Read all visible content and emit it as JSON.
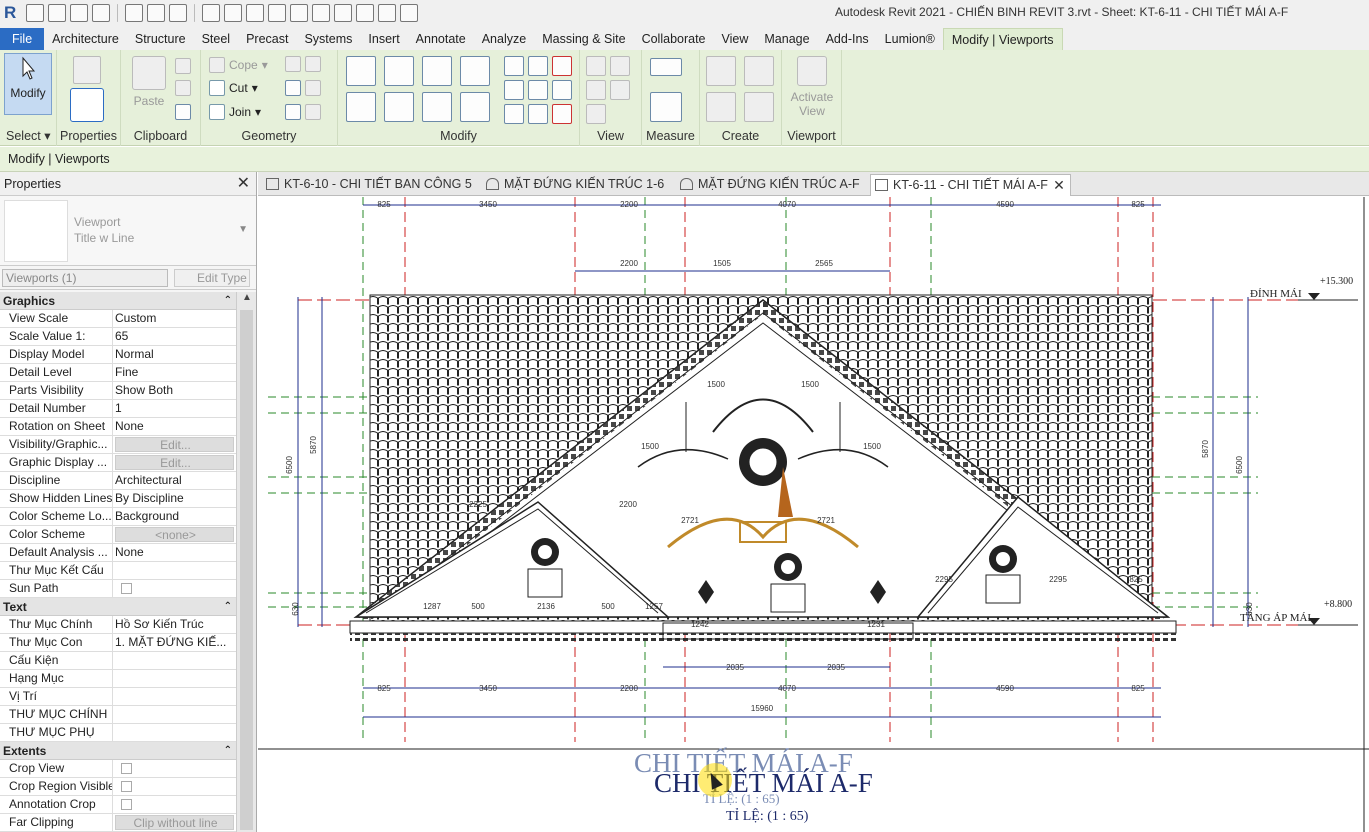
{
  "app": {
    "logo": "R",
    "title": "Autodesk Revit 2021 - CHIẾN BINH REVIT 3.rvt - Sheet: KT-6-11 - CHI TIẾT MÁI A-F"
  },
  "ribbon_tabs": [
    "File",
    "Architecture",
    "Structure",
    "Steel",
    "Precast",
    "Systems",
    "Insert",
    "Annotate",
    "Analyze",
    "Massing & Site",
    "Collaborate",
    "View",
    "Manage",
    "Add-Ins",
    "Lumion®",
    "Modify | Viewports"
  ],
  "active_tab": "Modify | Viewports",
  "ribbon": {
    "modify_label": "Modify",
    "select_label": "Select",
    "properties_label": "Properties",
    "paste_label": "Paste",
    "clipboard_label": "Clipboard",
    "cope_label": "Cope",
    "cut_label": "Cut",
    "join_label": "Join",
    "geometry_label": "Geometry",
    "modify_panel_label": "Modify",
    "view_label": "View",
    "measure_label": "Measure",
    "create_label": "Create",
    "activate_view_label": "Activate View",
    "viewport_label": "Viewport"
  },
  "options_bar": {
    "context": "Modify | Viewports"
  },
  "properties": {
    "title": "Properties",
    "type_name_1": "Viewport",
    "type_name_2": "Title w Line",
    "filter": "Viewports (1)",
    "edit_type": "Edit Type",
    "groups": [
      {
        "name": "Graphics",
        "rows": [
          {
            "k": "View Scale",
            "v": "Custom"
          },
          {
            "k": "Scale Value    1:",
            "v": "65"
          },
          {
            "k": "Display Model",
            "v": "Normal"
          },
          {
            "k": "Detail Level",
            "v": "Fine"
          },
          {
            "k": "Parts Visibility",
            "v": "Show Both"
          },
          {
            "k": "Detail Number",
            "v": "1"
          },
          {
            "k": "Rotation on Sheet",
            "v": "None"
          },
          {
            "k": "Visibility/Graphic...",
            "v": "Edit..."
          },
          {
            "k": "Graphic Display ...",
            "v": "Edit..."
          },
          {
            "k": "Discipline",
            "v": "Architectural"
          },
          {
            "k": "Show Hidden Lines",
            "v": "By Discipline"
          },
          {
            "k": "Color Scheme Lo...",
            "v": "Background"
          },
          {
            "k": "Color Scheme",
            "v": "<none>"
          },
          {
            "k": "Default Analysis ...",
            "v": "None"
          },
          {
            "k": "Thư Mục Kết Cấu",
            "v": ""
          },
          {
            "k": "Sun Path",
            "v": ""
          }
        ]
      },
      {
        "name": "Text",
        "rows": [
          {
            "k": "Thư Mục Chính",
            "v": "Hồ Sơ Kiến Trúc"
          },
          {
            "k": "Thư Mục Con",
            "v": "1. MẶT ĐỨNG KIẾ..."
          },
          {
            "k": "Cấu Kiện",
            "v": ""
          },
          {
            "k": "Hạng Mục",
            "v": ""
          },
          {
            "k": "Vị Trí",
            "v": ""
          },
          {
            "k": "THƯ MỤC CHÍNH",
            "v": ""
          },
          {
            "k": "THƯ MỤC PHỤ",
            "v": ""
          }
        ]
      },
      {
        "name": "Extents",
        "rows": [
          {
            "k": "Crop View",
            "v": ""
          },
          {
            "k": "Crop Region Visible",
            "v": ""
          },
          {
            "k": "Annotation Crop",
            "v": ""
          },
          {
            "k": "Far Clipping",
            "v": "Clip without line"
          }
        ]
      }
    ]
  },
  "view_tabs": [
    {
      "label": "KT-6-10 - CHI TIẾT BAN CÔNG 5",
      "active": false
    },
    {
      "label": "MẶT ĐỨNG KIẾN TRÚC 1-6",
      "active": false
    },
    {
      "label": "MẶT ĐỨNG KIẾN TRÚC A-F",
      "active": false
    },
    {
      "label": "KT-6-11 - CHI TIẾT MÁI A-F",
      "active": true
    }
  ],
  "drawing": {
    "top_dims": [
      "825",
      "3450",
      "2200",
      "4070",
      "4590",
      "825"
    ],
    "mid_dims": [
      "2200",
      "1505",
      "2565"
    ],
    "bottom_dims": [
      "825",
      "3450",
      "2200",
      "4070",
      "4590",
      "825"
    ],
    "bottom_sub_dims": [
      "2035",
      "2035"
    ],
    "overall_dim": "15960",
    "inner_dims": [
      "1500",
      "1500",
      "1500",
      "1500",
      "2721",
      "2721",
      "2225",
      "1287",
      "500",
      "2136",
      "500",
      "1257",
      "1242",
      "1231",
      "2295",
      "2295",
      "825",
      "2200"
    ],
    "left_vert_dims": [
      "6500",
      "5870",
      "630"
    ],
    "right_vert_dims": [
      "5870",
      "6500",
      "630"
    ],
    "level_top_name": "ĐỈNH MÁI",
    "level_top_value": "+15.300",
    "level_bottom_name": "TẦNG ÁP MÁI",
    "level_bottom_value": "+8.800",
    "view_title": "CHI TIẾT MÁI A-F",
    "view_scale": "TỈ LỆ: (1 : 65)"
  },
  "colors": {
    "file_tab": "#2b6cc4",
    "ribbon_bg": "#e6f0da",
    "dim_line": "#1c2c8c",
    "grid_red": "#cc2222",
    "grid_green": "#2a8a2a",
    "ornament": "#c08a2a"
  }
}
